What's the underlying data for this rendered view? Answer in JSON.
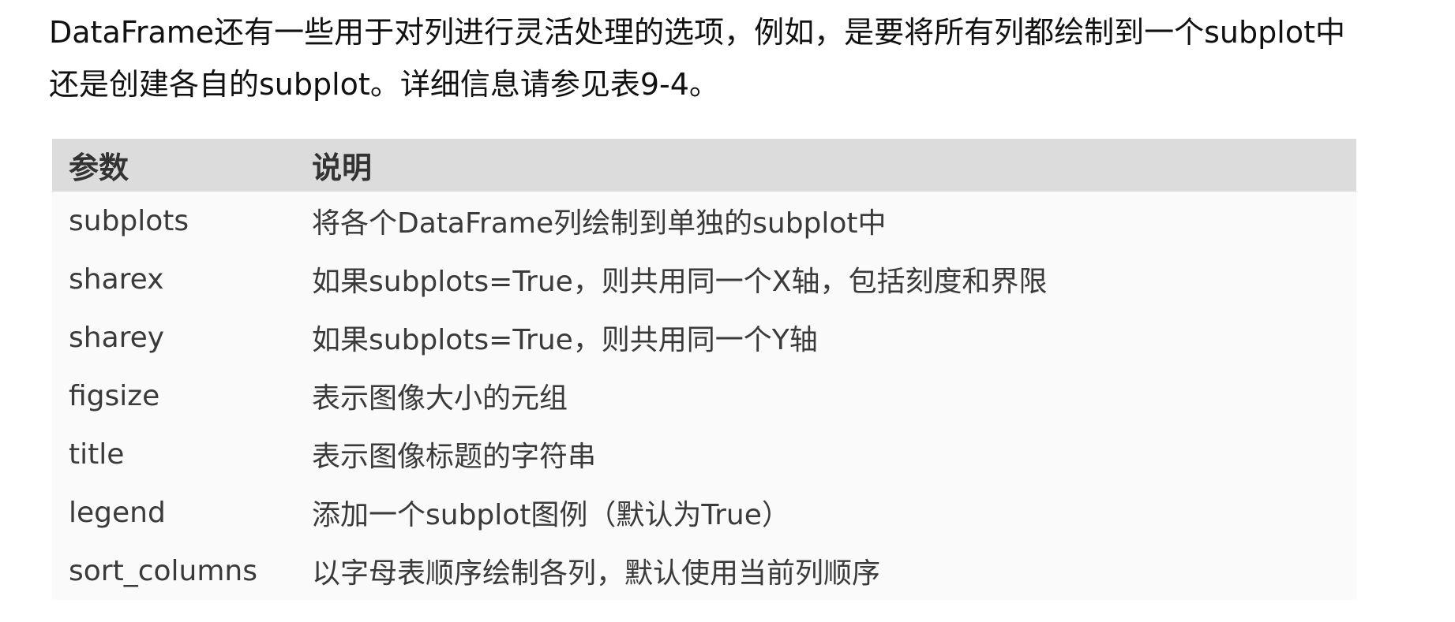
{
  "intro": {
    "line1": "DataFrame还有一些用于对列进行灵活处理的选项，例如，是要将所有列都绘制到一个subplot中",
    "line2": "还是创建各自的subplot。详细信息请参见表9-4。"
  },
  "table": {
    "headers": [
      "参数",
      "说明"
    ],
    "rows": [
      {
        "param": "subplots",
        "desc": "将各个DataFrame列绘制到单独的subplot中"
      },
      {
        "param": "sharex",
        "desc": "如果subplots=True，则共用同一个X轴，包括刻度和界限"
      },
      {
        "param": "sharey",
        "desc": "如果subplots=True，则共用同一个Y轴"
      },
      {
        "param": "figsize",
        "desc": "表示图像大小的元组"
      },
      {
        "param": "title",
        "desc": "表示图像标题的字符串"
      },
      {
        "param": "legend",
        "desc": "添加一个subplot图例（默认为True）"
      },
      {
        "param": "sort_columns",
        "desc": "以字母表顺序绘制各列，默认使用当前列顺序"
      }
    ]
  }
}
